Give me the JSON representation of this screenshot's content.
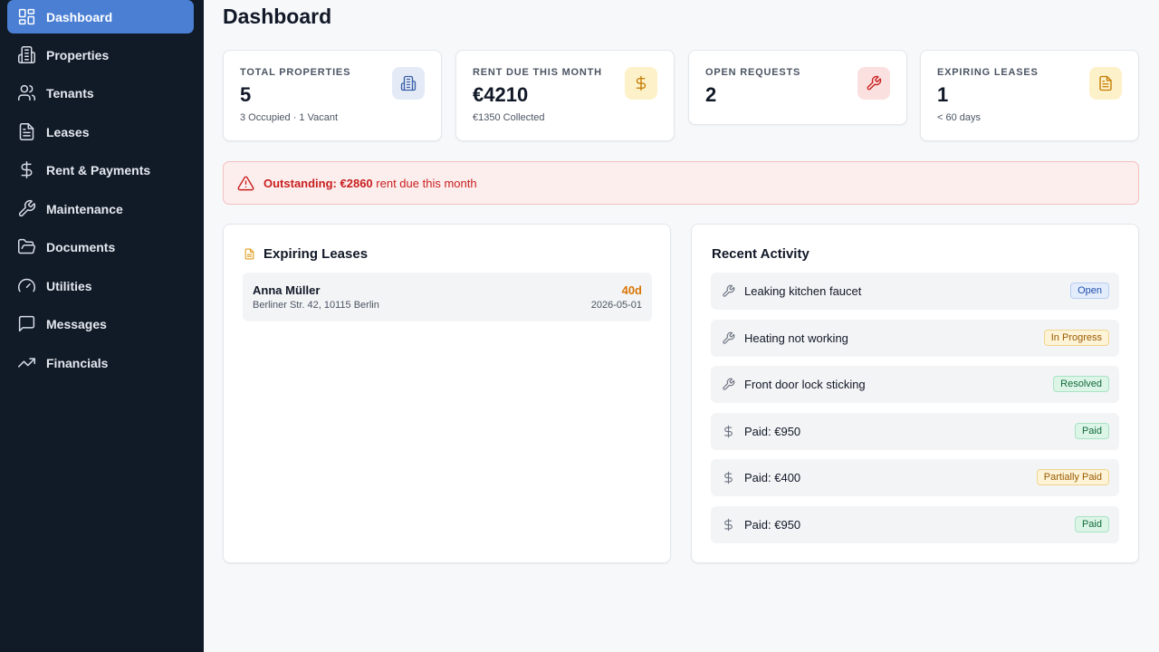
{
  "sidebar": {
    "items": [
      {
        "label": "Dashboard",
        "icon": "dashboard-icon",
        "active": true
      },
      {
        "label": "Properties",
        "icon": "building-icon"
      },
      {
        "label": "Tenants",
        "icon": "users-icon"
      },
      {
        "label": "Leases",
        "icon": "document-icon"
      },
      {
        "label": "Rent & Payments",
        "icon": "dollar-icon"
      },
      {
        "label": "Maintenance",
        "icon": "wrench-icon"
      },
      {
        "label": "Documents",
        "icon": "folder-icon"
      },
      {
        "label": "Utilities",
        "icon": "gauge-icon"
      },
      {
        "label": "Messages",
        "icon": "message-icon"
      },
      {
        "label": "Financials",
        "icon": "trending-up-icon"
      }
    ]
  },
  "page": {
    "title": "Dashboard"
  },
  "stats": [
    {
      "label": "TOTAL PROPERTIES",
      "value": "5",
      "sub": "3 Occupied · 1 Vacant",
      "icon": "building-icon"
    },
    {
      "label": "RENT DUE THIS MONTH",
      "value": "€4210",
      "sub": "€1350 Collected",
      "icon": "dollar-icon"
    },
    {
      "label": "OPEN REQUESTS",
      "value": "2",
      "sub": "",
      "icon": "wrench-icon"
    },
    {
      "label": "EXPIRING LEASES",
      "value": "1",
      "sub": "< 60 days",
      "icon": "document-icon"
    }
  ],
  "alert": {
    "prefix": "Outstanding:",
    "amount": "€2860",
    "suffix": "rent due this month"
  },
  "expiring": {
    "title": "Expiring Leases",
    "rows": [
      {
        "name": "Anna Müller",
        "address": "Berliner Str. 42, 10115 Berlin",
        "days": "40d",
        "date": "2026-05-01"
      }
    ]
  },
  "activity": {
    "title": "Recent Activity",
    "rows": [
      {
        "text": "Leaking kitchen faucet",
        "icon": "wrench-icon",
        "status": "Open"
      },
      {
        "text": "Heating not working",
        "icon": "wrench-icon",
        "status": "In Progress"
      },
      {
        "text": "Front door lock sticking",
        "icon": "wrench-icon",
        "status": "Resolved"
      },
      {
        "text": "Paid: €950",
        "icon": "dollar-icon",
        "status": "Paid"
      },
      {
        "text": "Paid: €400",
        "icon": "dollar-icon",
        "status": "Partially Paid"
      },
      {
        "text": "Paid: €950",
        "icon": "dollar-icon",
        "status": "Paid"
      }
    ]
  },
  "colors": {
    "sidebar_bg": "#111a27",
    "active_nav": "#4a7fd4",
    "alert_red": "#c81e1e",
    "warning_amber": "#d97706"
  }
}
